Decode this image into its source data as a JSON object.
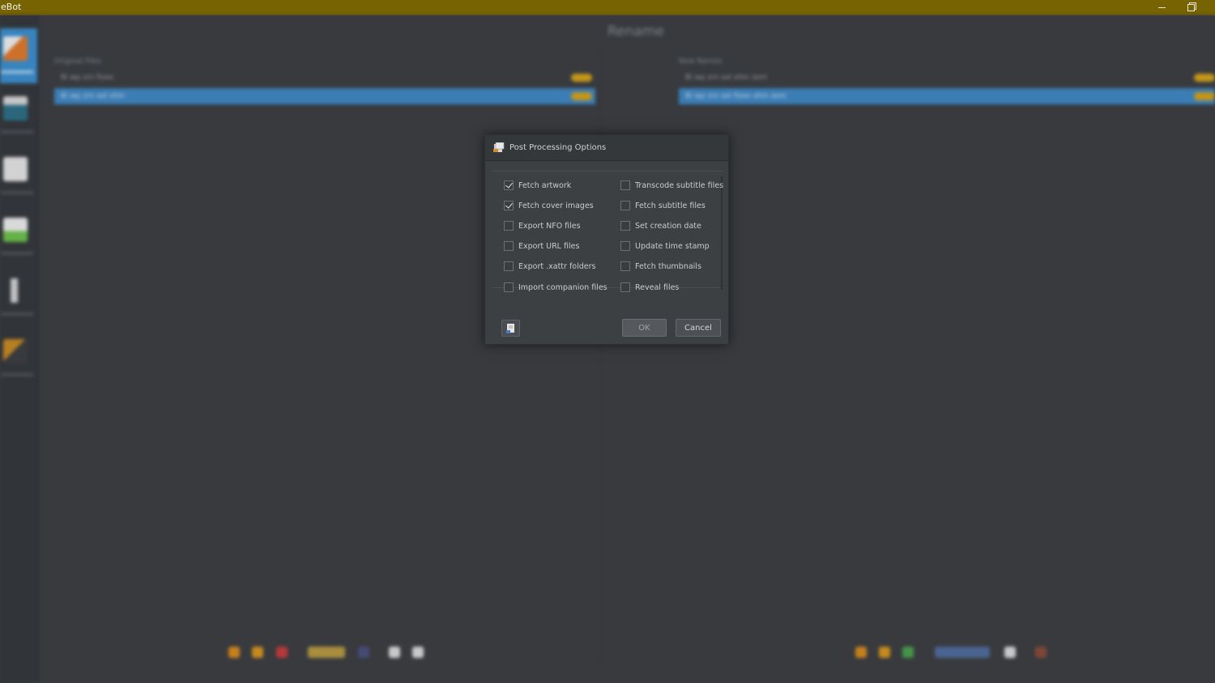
{
  "window": {
    "title": "eBot"
  },
  "app": {
    "header_title": "Rename",
    "left_panel": {
      "label": "Original Files",
      "rows": [
        "Bi wp zrn fixes",
        "Bi wp zrn sel xhin"
      ]
    },
    "right_panel": {
      "label": "New Names",
      "rows": [
        "Bi wp zrn sel xhin zem",
        "Bi wp zrn sel fixes xhin zem"
      ]
    }
  },
  "dialog": {
    "title": "Post Processing Options",
    "options_left": [
      {
        "label": "Fetch artwork",
        "checked": true
      },
      {
        "label": "Fetch cover images",
        "checked": true
      },
      {
        "label": "Export NFO files",
        "checked": false
      },
      {
        "label": "Export URL files",
        "checked": false
      },
      {
        "label": "Export .xattr folders",
        "checked": false
      },
      {
        "label": "Import companion files",
        "checked": false
      }
    ],
    "options_right": [
      {
        "label": "Transcode subtitle files",
        "checked": false
      },
      {
        "label": "Fetch subtitle files",
        "checked": false
      },
      {
        "label": "Set creation date",
        "checked": false
      },
      {
        "label": "Update time stamp",
        "checked": false
      },
      {
        "label": "Fetch thumbnails",
        "checked": false
      },
      {
        "label": "Reveal files",
        "checked": false
      }
    ],
    "ok_label": "OK",
    "cancel_label": "Cancel"
  },
  "colors": {
    "titlebar": "#776300",
    "accent_blue": "#3e87c4",
    "pill_orange": "#d6a317"
  }
}
